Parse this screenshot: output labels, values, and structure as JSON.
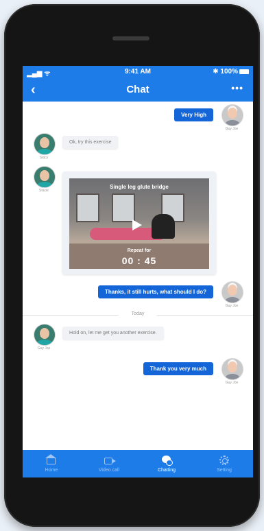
{
  "status_bar": {
    "signal": "▂▄▆ ᯤ",
    "time": "9:41 AM",
    "battery": "✱ 100%"
  },
  "header": {
    "back": "‹",
    "title": "Chat",
    "more": "•••"
  },
  "messages": [
    {
      "side": "out",
      "text": "Very High",
      "name": "Guy Joe"
    },
    {
      "side": "in",
      "text": "Ok, try this exercise",
      "name": "Stacy"
    },
    {
      "side": "in",
      "type": "video",
      "name": "Stacie",
      "video": {
        "title": "Single leg glute bridge",
        "repeat_label": "Repeat for",
        "timer": "00 : 45"
      }
    },
    {
      "side": "out",
      "text": "Thanks, it still hurts, what should I do?",
      "name": "Guy Joe"
    },
    {
      "side": "in",
      "text": "Hold on, let me get you another exercise.",
      "name": "Guy Joe"
    },
    {
      "side": "out",
      "text": "Thank you very much",
      "name": "Guy Joe"
    }
  ],
  "divider_label": "Today",
  "tabs": [
    {
      "label": "Home",
      "icon": "home-icon",
      "active": false
    },
    {
      "label": "Video call",
      "icon": "video-icon",
      "active": false
    },
    {
      "label": "Chatting",
      "icon": "chat-icon",
      "active": true
    },
    {
      "label": "Setting",
      "icon": "gear-icon",
      "active": false
    }
  ],
  "colors": {
    "accent": "#1e7ce8",
    "bubble_out": "#1466d8",
    "bubble_in": "#f0f2f5"
  }
}
